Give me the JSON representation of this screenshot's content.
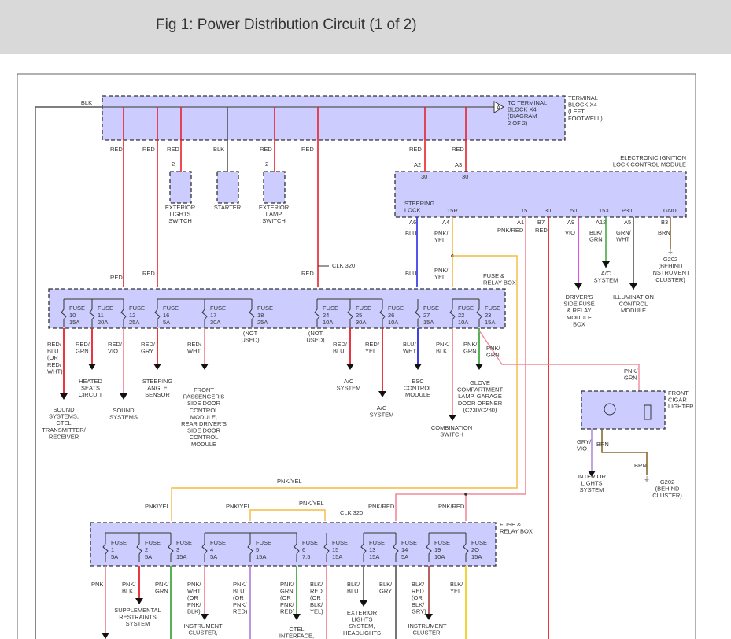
{
  "header": {
    "title": "Fig 1: Power Distribution Circuit (1 of 2)"
  },
  "colors": {
    "red": "#e8202a",
    "pink": "#f28a9a",
    "blk": "#555555",
    "blu": "#2a2ae6",
    "vio": "#e020e0",
    "grn": "#44aa44",
    "brn": "#8a6a2a",
    "yel": "#f0d020",
    "orange": "#f5b942",
    "box_fill": "#ccccff",
    "label_blue": "#2255cc"
  },
  "labels": {
    "blk_main": [
      "BLK"
    ],
    "terminal_block": [
      "TERMINAL",
      "BLOCK X4",
      "(LEFT",
      "FOOTWELL)"
    ],
    "to_terminal": [
      "TO TERMINAL",
      "BLOCK X4",
      "(DIAGRAM",
      "2 OF 2)"
    ],
    "terminal_letter": [
      "A"
    ],
    "w_red1": [
      "RED"
    ],
    "w_red2": [
      "RED"
    ],
    "w_red3": [
      "RED"
    ],
    "w_blk": [
      "BLK"
    ],
    "w_red4": [
      "RED"
    ],
    "w_red5": [
      "RED"
    ],
    "w_red6": [
      "RED"
    ],
    "w_red7": [
      "RED"
    ],
    "pin_2a": [
      "2"
    ],
    "pin_2b": [
      "2"
    ],
    "ext_lights_switch": [
      "EXTERIOR",
      "LIGHTS",
      "SWITCH"
    ],
    "starter": [
      "STARTER"
    ],
    "ext_lamp_switch": [
      "EXTERIOR",
      "LAMP",
      "SWITCH"
    ],
    "eis_title": [
      "ELECTRONIC IGNITION",
      "LOCK CONTROL MODULE"
    ],
    "pin_a2": [
      "A2"
    ],
    "pin_a3": [
      "A3"
    ],
    "t30a": [
      "30"
    ],
    "t30b": [
      "30"
    ],
    "steering_lock": [
      "STEERING",
      "LOCK"
    ],
    "t15r": [
      "15R"
    ],
    "t15": [
      "15"
    ],
    "t30c": [
      "30"
    ],
    "t50": [
      "50"
    ],
    "t15x": [
      "15X"
    ],
    "tp30": [
      "P30"
    ],
    "tgnd": [
      "GND"
    ],
    "pin_a6": [
      "A6"
    ],
    "pin_a4": [
      "A4"
    ],
    "pin_a1": [
      "A1"
    ],
    "pin_b7": [
      "B7"
    ],
    "pin_a9": [
      "A9"
    ],
    "pin_a12": [
      "A12"
    ],
    "pin_a5": [
      "A5"
    ],
    "pin_b3": [
      "B3"
    ],
    "w_blu1": [
      "BLU"
    ],
    "w_blu2": [
      "BLU"
    ],
    "w_pnkyel1": [
      "PNK/",
      "YEL"
    ],
    "w_pnkyel2": [
      "PNK/",
      "YEL"
    ],
    "w_pnkred": [
      "PNK/RED"
    ],
    "w_redb7": [
      "RED"
    ],
    "w_vio": [
      "VIO"
    ],
    "w_blkgrn": [
      "BLK/",
      "GRN"
    ],
    "w_grnwht": [
      "GRN/",
      "WHT"
    ],
    "w_brn": [
      "BRN"
    ],
    "drivers_fuse": [
      "DRIVER'S",
      "SIDE FUSE",
      "& RELAY",
      "MODULE",
      "BOX"
    ],
    "ac_system_top": [
      "A/C",
      "SYSTEM"
    ],
    "illumination": [
      "ILLUMINATION",
      "CONTROL",
      "MODULE"
    ],
    "g202_top": [
      "G202",
      "(BEHIND",
      "INSTRUMENT",
      "CLUSTER)"
    ],
    "w_red_in1": [
      "RED"
    ],
    "w_red_in2": [
      "RED"
    ],
    "w_red_in3": [
      "RED"
    ],
    "clk320a": [
      "CLK 320"
    ],
    "fuse_relay_box1": [
      "FUSE &",
      "RELAY BOX"
    ],
    "o_redblu": [
      "RED/",
      "BLU",
      "(OR",
      "RED/",
      "WHT)"
    ],
    "sound_ctel": [
      "SOUND",
      "SYSTEMS,",
      "CTEL",
      "TRANSMITTER/",
      "RECEIVER"
    ],
    "o_redgrn": [
      "RED/",
      "GRN"
    ],
    "heated_seats": [
      "HEATED",
      "SEATS",
      "CIRCUIT"
    ],
    "o_redvio": [
      "RED/",
      "VIO"
    ],
    "sound_systems": [
      "SOUND",
      "SYSTEMS"
    ],
    "o_redgry": [
      "RED/",
      "GRY"
    ],
    "steering_angle": [
      "STEERING",
      "ANGLE",
      "SENSOR"
    ],
    "o_redwht": [
      "RED/",
      "WHT"
    ],
    "door_modules": [
      "FRONT",
      "PASSENGER'S",
      "SIDE DOOR",
      "CONTROL",
      "MODULE,",
      "REAR DRIVER'S",
      "SIDE DOOR",
      "CONTROL",
      "MODULE"
    ],
    "not_used1": [
      "(NOT",
      "USED)"
    ],
    "not_used2": [
      "(NOT",
      "USED)"
    ],
    "o_redblu2": [
      "RED/",
      "BLU"
    ],
    "ac_system1": [
      "A/C",
      "SYSTEM"
    ],
    "o_redyel": [
      "RED/",
      "YEL"
    ],
    "ac_system2": [
      "A/C",
      "SYSTEM"
    ],
    "o_bluwht": [
      "BLU/",
      "WHT"
    ],
    "esc_module": [
      "ESC",
      "CONTROL",
      "MODULE"
    ],
    "o_pnkblk": [
      "PNK/",
      "BLK"
    ],
    "combination_switch": [
      "COMBINATION",
      "SWITCH"
    ],
    "o_pnkgrn": [
      "PNK/",
      "GRN"
    ],
    "o_pnkgrn2": [
      "PNK/",
      "GRN"
    ],
    "glove": [
      "GLOVE",
      "COMPARTMENT",
      "LAMP, GARAGE",
      "DOOR OPENER",
      "(C230/C280)"
    ],
    "o_pnkgrn3": [
      "PNK/",
      "GRN"
    ],
    "cigar_lighter": [
      "FRONT",
      "CIGAR",
      "LIGHTER"
    ],
    "o_gryvio": [
      "GRY/",
      "VIO"
    ],
    "o_brn1": [
      "BRN"
    ],
    "o_brn2": [
      "BRN"
    ],
    "interior_lights": [
      "INTERIOR",
      "LIGHTS",
      "SYSTEM"
    ],
    "g202_bottom": [
      "G202",
      "(BEHIND",
      "CLUSTER)"
    ],
    "pnkyel_mid": [
      "PNK/YEL"
    ],
    "pnkyel_b1": [
      "PNK/YEL"
    ],
    "pnkyel_b2": [
      "PNK/YEL"
    ],
    "pnkyel_b3": [
      "PNK/YEL"
    ],
    "clk320b": [
      "CLK 320"
    ],
    "pnkred_b1": [
      "PNK/RED"
    ],
    "pnkred_b2": [
      "PNK/RED"
    ],
    "fuse_relay_box2": [
      "FUSE &",
      "RELAY BOX"
    ],
    "b_pnk": [
      "PNK"
    ],
    "b_pnkblk": [
      "PNK/",
      "BLK"
    ],
    "srs": [
      "SUPPLEMENTAL",
      "RESTRAINTS",
      "SYSTEM"
    ],
    "b_pnkgrn": [
      "PNK/",
      "GRN"
    ],
    "b_pnkwht": [
      "PNK/",
      "WHT",
      "(OR",
      "PNK/",
      "BLK)"
    ],
    "instr1": [
      "INSTRUMENT",
      "CLUSTER,"
    ],
    "b_pnkblu": [
      "PNK/",
      "BLU",
      "(OR",
      "PNK/",
      "RED)"
    ],
    "b_pnkgrn2": [
      "PNK/",
      "GRN",
      "(OR",
      "PNK/",
      "RED)"
    ],
    "ctel": [
      "CTEL",
      "INTERFACE,"
    ],
    "b_blkred": [
      "BLK/",
      "RED",
      "(OR",
      "BLK/",
      "YEL)"
    ],
    "b_blkblu": [
      "BLK/",
      "BLU"
    ],
    "ext_lights_sys": [
      "EXTERIOR",
      "LIGHTS",
      "SYSTEM,",
      "HEADLIGHTS"
    ],
    "b_blkgry": [
      "BLK/",
      "GRY"
    ],
    "b_blkred2": [
      "BLK/",
      "RED",
      "(OR",
      "BLK/",
      "GRY)"
    ],
    "instr2": [
      "INSTRUMENT",
      "CLUSTER,"
    ],
    "b_blkyel": [
      "BLK/",
      "YEL"
    ]
  },
  "fuse_box_1": {
    "fuse_label": "FUSE",
    "fuses": [
      {
        "num": "10",
        "amp": "15A"
      },
      {
        "num": "11",
        "amp": "20A"
      },
      {
        "num": "12",
        "amp": "25A"
      },
      {
        "num": "16",
        "amp": "5A"
      },
      {
        "num": "17",
        "amp": "30A"
      },
      {
        "num": "18",
        "amp": "25A"
      },
      {
        "num": "24",
        "amp": "10A"
      },
      {
        "num": "25",
        "amp": "30A"
      },
      {
        "num": "26",
        "amp": "10A"
      },
      {
        "num": "27",
        "amp": "15A"
      },
      {
        "num": "22",
        "amp": "10A"
      },
      {
        "num": "23",
        "amp": "15A"
      }
    ]
  },
  "fuse_box_2": {
    "fuse_label": "FUSE",
    "fuses": [
      {
        "num": "1",
        "amp": "5A"
      },
      {
        "num": "2",
        "amp": "5A"
      },
      {
        "num": "3",
        "amp": "15A"
      },
      {
        "num": "4",
        "amp": "5A"
      },
      {
        "num": "5",
        "amp": "15A"
      },
      {
        "num": "6",
        "amp": "7.5"
      },
      {
        "num": "15",
        "amp": "15A"
      },
      {
        "num": "13",
        "amp": "15A"
      },
      {
        "num": "14",
        "amp": "5A"
      },
      {
        "num": "19",
        "amp": "10A"
      },
      {
        "num": "2O",
        "amp": "15A"
      }
    ]
  }
}
